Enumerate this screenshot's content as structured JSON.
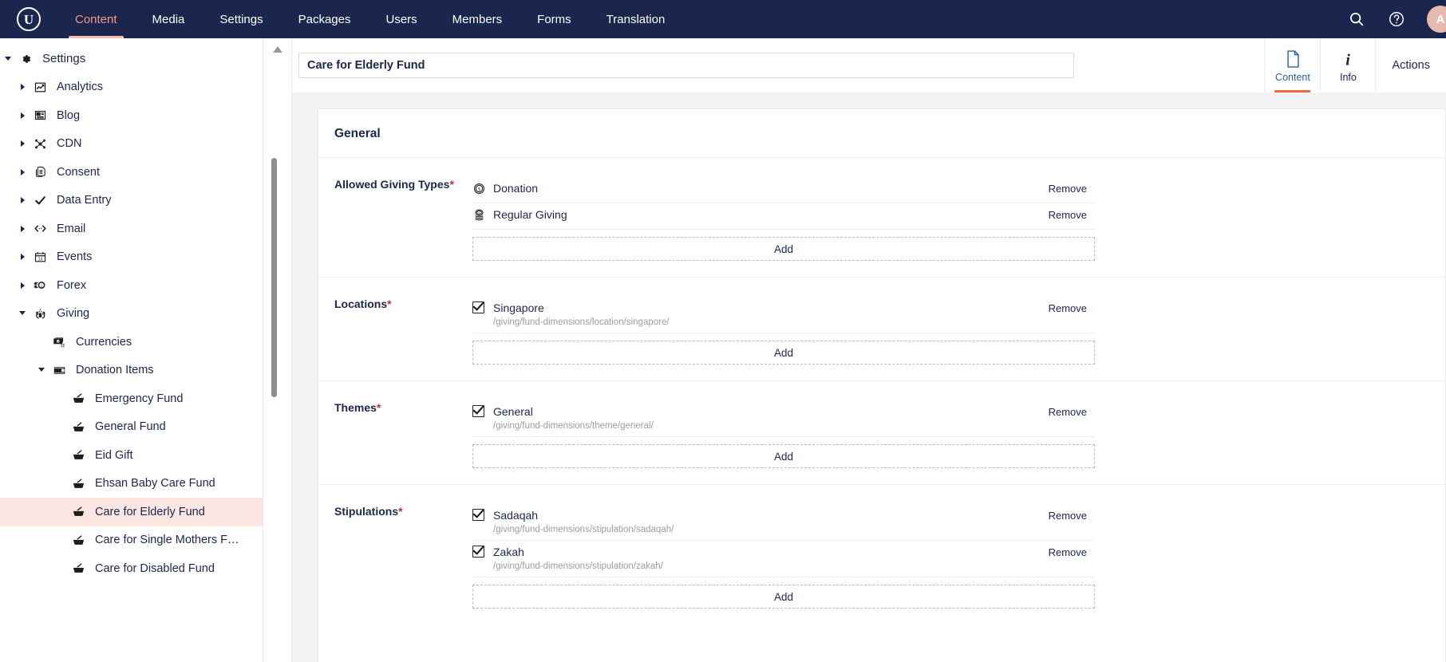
{
  "topnav": {
    "logo": "U",
    "items": [
      {
        "label": "Content",
        "active": true
      },
      {
        "label": "Media",
        "active": false
      },
      {
        "label": "Settings",
        "active": false
      },
      {
        "label": "Packages",
        "active": false
      },
      {
        "label": "Users",
        "active": false
      },
      {
        "label": "Members",
        "active": false
      },
      {
        "label": "Forms",
        "active": false
      },
      {
        "label": "Translation",
        "active": false
      }
    ],
    "search_icon": "search-icon",
    "help_icon": "help-icon",
    "avatar_initial": "A",
    "background": "#1b264f",
    "active_color": "#f5997e"
  },
  "sidebar": {
    "tree": [
      {
        "label": "Settings",
        "level": 0,
        "caret": "open",
        "icon": "gear-icon",
        "selected": false
      },
      {
        "label": "Analytics",
        "level": 1,
        "caret": "closed",
        "icon": "chart-icon",
        "selected": false
      },
      {
        "label": "Blog",
        "level": 1,
        "caret": "closed",
        "icon": "article-icon",
        "selected": false
      },
      {
        "label": "CDN",
        "level": 1,
        "caret": "closed",
        "icon": "network-icon",
        "selected": false
      },
      {
        "label": "Consent",
        "level": 1,
        "caret": "closed",
        "icon": "documents-icon",
        "selected": false
      },
      {
        "label": "Data Entry",
        "level": 1,
        "caret": "closed",
        "icon": "check-icon",
        "selected": false
      },
      {
        "label": "Email",
        "level": 1,
        "caret": "closed",
        "icon": "code-icon",
        "selected": false
      },
      {
        "label": "Events",
        "level": 1,
        "caret": "closed",
        "icon": "calendar-icon",
        "selected": false
      },
      {
        "label": "Forex",
        "level": 1,
        "caret": "closed",
        "icon": "coins-icon",
        "selected": false
      },
      {
        "label": "Giving",
        "level": 1,
        "caret": "open",
        "icon": "hands-heart-icon",
        "selected": false
      },
      {
        "label": "Currencies",
        "level": 2,
        "caret": "none",
        "icon": "money-icon",
        "selected": false
      },
      {
        "label": "Donation Items",
        "level": 2,
        "caret": "open",
        "icon": "film-icon",
        "selected": false
      },
      {
        "label": "Emergency Fund",
        "level": 3,
        "caret": "none",
        "icon": "basket-icon",
        "selected": false
      },
      {
        "label": "General Fund",
        "level": 3,
        "caret": "none",
        "icon": "basket-icon",
        "selected": false
      },
      {
        "label": "Eid Gift",
        "level": 3,
        "caret": "none",
        "icon": "basket-icon",
        "selected": false
      },
      {
        "label": "Ehsan Baby Care Fund",
        "level": 3,
        "caret": "none",
        "icon": "basket-icon",
        "selected": false
      },
      {
        "label": "Care for Elderly Fund",
        "level": 3,
        "caret": "none",
        "icon": "basket-icon",
        "selected": true
      },
      {
        "label": "Care for Single Mothers F…",
        "level": 3,
        "caret": "none",
        "icon": "basket-icon",
        "selected": false
      },
      {
        "label": "Care for Disabled Fund",
        "level": 3,
        "caret": "none",
        "icon": "basket-icon",
        "selected": false
      }
    ],
    "selected_background": "#fbe6e2"
  },
  "editor": {
    "title_value": "Care for Elderly Fund",
    "tabs": [
      {
        "label": "Content",
        "icon": "document-icon",
        "active": true
      },
      {
        "label": "Info",
        "icon": "info-icon",
        "active": false
      }
    ],
    "actions_label": "Actions"
  },
  "content": {
    "card_title": "General",
    "add_label": "Add",
    "remove_label": "Remove",
    "groups": [
      {
        "label": "Allowed Giving Types",
        "required": true,
        "items": [
          {
            "name": "Donation",
            "path": "",
            "icon": "coin-dollar-icon",
            "checkbox": false
          },
          {
            "name": "Regular Giving",
            "path": "",
            "icon": "coin-stack-icon",
            "checkbox": false
          }
        ]
      },
      {
        "label": "Locations",
        "required": true,
        "items": [
          {
            "name": "Singapore",
            "path": "/giving/fund-dimensions/location/singapore/",
            "icon": "checkbox-icon",
            "checkbox": true
          }
        ]
      },
      {
        "label": "Themes",
        "required": true,
        "items": [
          {
            "name": "General",
            "path": "/giving/fund-dimensions/theme/general/",
            "icon": "checkbox-icon",
            "checkbox": true
          }
        ]
      },
      {
        "label": "Stipulations",
        "required": true,
        "items": [
          {
            "name": "Sadaqah",
            "path": "/giving/fund-dimensions/stipulation/sadaqah/",
            "icon": "checkbox-icon",
            "checkbox": true
          },
          {
            "name": "Zakah",
            "path": "/giving/fund-dimensions/stipulation/zakah/",
            "icon": "checkbox-icon",
            "checkbox": true
          }
        ]
      }
    ]
  }
}
